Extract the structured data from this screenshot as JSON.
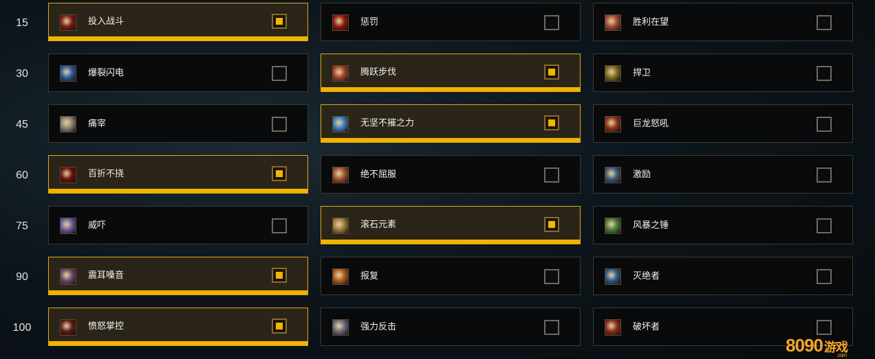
{
  "rows": [
    {
      "level": "15",
      "talents": [
        {
          "name": "投入战斗",
          "selected": true,
          "icon": "warrior-charge-icon",
          "color": "#7a1a12"
        },
        {
          "name": "惩罚",
          "selected": false,
          "icon": "red-shield-icon",
          "color": "#8a1a0a"
        },
        {
          "name": "胜利在望",
          "selected": false,
          "icon": "victory-icon",
          "color": "#a04a30"
        }
      ]
    },
    {
      "level": "30",
      "talents": [
        {
          "name": "爆裂闪电",
          "selected": false,
          "icon": "lightning-icon",
          "color": "#2a5a9a"
        },
        {
          "name": "腾跃步伐",
          "selected": true,
          "icon": "leap-icon",
          "color": "#a0402a"
        },
        {
          "name": "捍卫",
          "selected": false,
          "icon": "defend-icon",
          "color": "#7a6a20"
        }
      ]
    },
    {
      "level": "45",
      "talents": [
        {
          "name": "痛宰",
          "selected": false,
          "icon": "face-icon",
          "color": "#8a8070"
        },
        {
          "name": "无坚不摧之力",
          "selected": true,
          "icon": "blue-strike-icon",
          "color": "#3a7aba"
        },
        {
          "name": "巨龙怒吼",
          "selected": false,
          "icon": "dragon-roar-icon",
          "color": "#8a3018"
        }
      ]
    },
    {
      "level": "60",
      "talents": [
        {
          "name": "百折不挠",
          "selected": true,
          "icon": "demon-icon",
          "color": "#6a1010"
        },
        {
          "name": "绝不屈服",
          "selected": false,
          "icon": "fist-icon",
          "color": "#a05030"
        },
        {
          "name": "激励",
          "selected": false,
          "icon": "shout-icon",
          "color": "#3a5a7a"
        }
      ]
    },
    {
      "level": "75",
      "talents": [
        {
          "name": "威吓",
          "selected": false,
          "icon": "intimidate-icon",
          "color": "#6a5a9a"
        },
        {
          "name": "滚石元素",
          "selected": true,
          "icon": "rock-icon",
          "color": "#9a7a40"
        },
        {
          "name": "风暴之锤",
          "selected": false,
          "icon": "storm-hammer-icon",
          "color": "#4a7a3a"
        }
      ]
    },
    {
      "level": "90",
      "talents": [
        {
          "name": "震耳嗓音",
          "selected": true,
          "icon": "roar-icon",
          "color": "#6a4a6a"
        },
        {
          "name": "报复",
          "selected": false,
          "icon": "revenge-icon",
          "color": "#b05a20"
        },
        {
          "name": "灭绝者",
          "selected": false,
          "icon": "annihilator-icon",
          "color": "#2a5a8a"
        }
      ]
    },
    {
      "level": "100",
      "talents": [
        {
          "name": "愤怒掌控",
          "selected": true,
          "icon": "rage-icon",
          "color": "#5a1a1a"
        },
        {
          "name": "强力反击",
          "selected": false,
          "icon": "boulder-icon",
          "color": "#6a6a7a"
        },
        {
          "name": "破坏者",
          "selected": false,
          "icon": "ravager-icon",
          "color": "#8a2a1a"
        }
      ]
    }
  ],
  "watermark": {
    "brand": "8090",
    "brand_cn": "游戏",
    "domain": ".com",
    "color": "#f5a623"
  }
}
